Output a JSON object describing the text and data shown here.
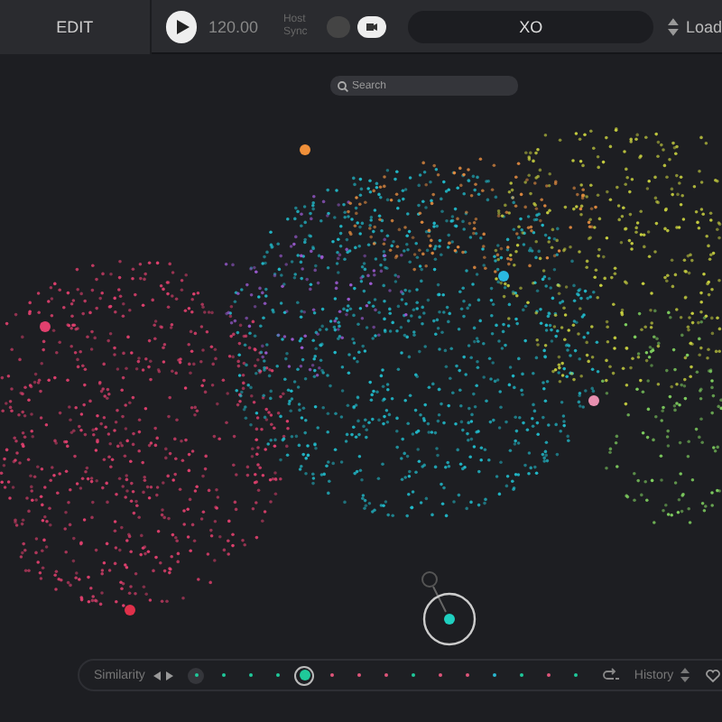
{
  "toolbar": {
    "mode_button": "EDIT",
    "playing": false,
    "tempo": "120.00",
    "host_sync_label": "Host Sync",
    "host_sync": false,
    "preset": "XO",
    "load_label": "Load"
  },
  "search": {
    "placeholder": "Search"
  },
  "sequencer": {
    "label": "Similarity",
    "history_label": "History",
    "favorite": false,
    "steps": [
      {
        "kind": "anchor",
        "selected": false,
        "color": "#1fc99a"
      },
      {
        "kind": "dot",
        "selected": false,
        "color": "#1fc99a"
      },
      {
        "kind": "dot",
        "selected": false,
        "color": "#1fc99a"
      },
      {
        "kind": "dot",
        "selected": false,
        "color": "#1fc99a"
      },
      {
        "kind": "dot",
        "selected": true,
        "color": "#1fc99a"
      },
      {
        "kind": "dot",
        "selected": false,
        "color": "#e0557a"
      },
      {
        "kind": "dot",
        "selected": false,
        "color": "#e0557a"
      },
      {
        "kind": "dot",
        "selected": false,
        "color": "#e0557a"
      },
      {
        "kind": "dot",
        "selected": false,
        "color": "#1fc99a"
      },
      {
        "kind": "dot",
        "selected": false,
        "color": "#e0557a"
      },
      {
        "kind": "dot",
        "selected": false,
        "color": "#e0557a"
      },
      {
        "kind": "dot",
        "selected": false,
        "color": "#2ab8d0"
      },
      {
        "kind": "dot",
        "selected": false,
        "color": "#1fc99a"
      },
      {
        "kind": "dot",
        "selected": false,
        "color": "#e0557a"
      },
      {
        "kind": "dot",
        "selected": false,
        "color": "#1fc99a"
      }
    ]
  }
}
